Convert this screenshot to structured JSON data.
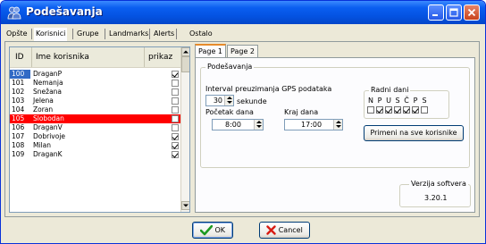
{
  "window": {
    "title": "Podešavanja"
  },
  "main_tabs": [
    "Opšte",
    "Korisnici",
    "Grupe",
    "Landmarks",
    "Alerts",
    "Ostalo"
  ],
  "list": {
    "headers": [
      "ID",
      "Ime korisnika",
      "prikaz"
    ],
    "rows": [
      {
        "id": "100",
        "name": "DraganP",
        "prikaz": true
      },
      {
        "id": "101",
        "name": "Nemanja",
        "prikaz": false
      },
      {
        "id": "102",
        "name": "Snežana",
        "prikaz": false
      },
      {
        "id": "103",
        "name": "Jelena",
        "prikaz": false
      },
      {
        "id": "104",
        "name": "Zoran",
        "prikaz": false
      },
      {
        "id": "105",
        "name": "Slobodan",
        "prikaz": false
      },
      {
        "id": "106",
        "name": "DraganV",
        "prikaz": false
      },
      {
        "id": "107",
        "name": "Dobrivoje",
        "prikaz": true
      },
      {
        "id": "108",
        "name": "Milan",
        "prikaz": true
      },
      {
        "id": "109",
        "name": "DraganK",
        "prikaz": true
      }
    ],
    "selected_id": "105",
    "focused_id": "100"
  },
  "inner_tabs": [
    "Page 1",
    "Page 2"
  ],
  "settings": {
    "group_title": "Podešavanja",
    "interval_label": "Interval preuzimanja GPS podataka",
    "interval_value": "30",
    "interval_unit": "sekunde",
    "start_label": "Početak dana",
    "start_value": "8:00",
    "end_label": "Kraj dana",
    "end_value": "17:00",
    "days_title": "Radni dani",
    "days": [
      {
        "label": "N",
        "checked": false
      },
      {
        "label": "P",
        "checked": true
      },
      {
        "label": "U",
        "checked": true
      },
      {
        "label": "S",
        "checked": true
      },
      {
        "label": "Č",
        "checked": true
      },
      {
        "label": "P",
        "checked": true
      },
      {
        "label": "S",
        "checked": false
      }
    ],
    "apply_all_label": "Primeni na sve korisnike"
  },
  "version": {
    "title": "Verzija softvera",
    "value": "3.20.1"
  },
  "buttons": {
    "ok": "OK",
    "cancel": "Cancel"
  },
  "colors": {
    "selected_row": "#ff0000",
    "titlebar": "#0a5ef0"
  }
}
